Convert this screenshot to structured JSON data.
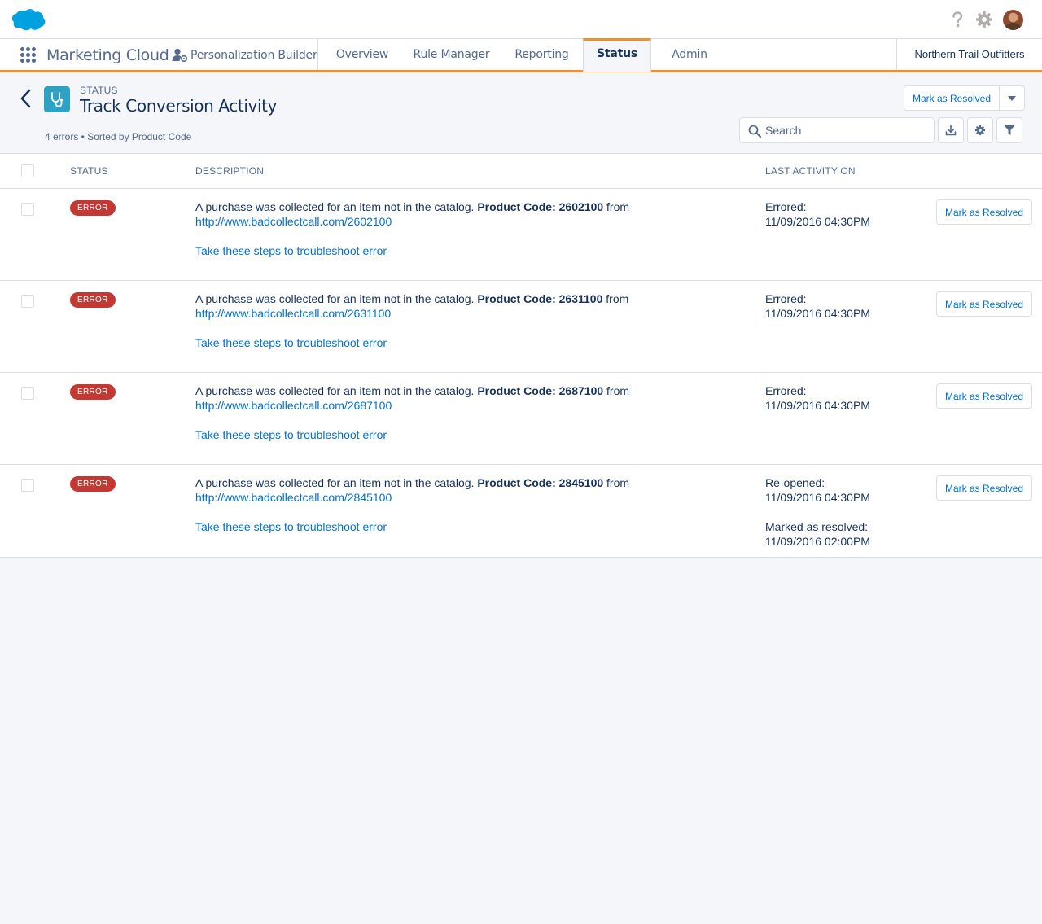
{
  "global_header": {
    "logo": "salesforce-cloud-logo",
    "icons": [
      "help-icon",
      "gear-icon",
      "user-avatar"
    ]
  },
  "nav": {
    "app_name": "Marketing Cloud",
    "product_label": "Personalization Builder",
    "tabs": [
      {
        "label": "Overview"
      },
      {
        "label": "Rule Manager"
      },
      {
        "label": "Reporting"
      },
      {
        "label": "Status",
        "active": true
      },
      {
        "label": "Admin"
      }
    ],
    "org_name": "Northern Trail Outfitters"
  },
  "page_header": {
    "eyebrow": "STATUS",
    "title": "Track Conversion Activity",
    "meta": "4 errors • Sorted by Product Code",
    "primary_button": "Mark as Resolved",
    "search_placeholder": "Search"
  },
  "table": {
    "columns": {
      "status": "STATUS",
      "description": "DESCRIPTION",
      "last_activity": "LAST ACTIVITY ON"
    },
    "rows": [
      {
        "badge": "ERROR",
        "desc_prefix": "A purchase was collected for an item not in the catalog.",
        "product_code": "Product Code: 2602100",
        "desc_suffix": "from",
        "url": "http://www.badcollectcall.com/2602100",
        "troubleshoot": "Take these steps to troubleshoot error",
        "activity1_label": "Errored:",
        "activity1_date": "11/09/2016 04:30PM",
        "activity2_label": "",
        "activity2_date": "",
        "action": "Mark as Resolved"
      },
      {
        "badge": "ERROR",
        "desc_prefix": "A purchase was collected for an item not in the catalog.",
        "product_code": "Product Code: 2631100",
        "desc_suffix": "from",
        "url": "http://www.badcollectcall.com/2631100",
        "troubleshoot": "Take these steps to troubleshoot error",
        "activity1_label": "Errored:",
        "activity1_date": "11/09/2016 04:30PM",
        "activity2_label": "",
        "activity2_date": "",
        "action": "Mark as Resolved"
      },
      {
        "badge": "ERROR",
        "desc_prefix": "A purchase was collected for an item not in the catalog.",
        "product_code": "Product Code: 2687100",
        "desc_suffix": "from",
        "url": "http://www.badcollectcall.com/2687100",
        "troubleshoot": "Take these steps to troubleshoot error",
        "activity1_label": "Errored:",
        "activity1_date": "11/09/2016 04:30PM",
        "activity2_label": "",
        "activity2_date": "",
        "action": "Mark as Resolved"
      },
      {
        "badge": "ERROR",
        "desc_prefix": "A purchase was collected for an item not in the catalog.",
        "product_code": "Product Code: 2845100",
        "desc_suffix": "from",
        "url": "http://www.badcollectcall.com/2845100",
        "troubleshoot": "Take these steps to troubleshoot error",
        "activity1_label": "Re-opened:",
        "activity1_date": "11/09/2016 04:30PM",
        "activity2_label": "Marked as resolved:",
        "activity2_date": "11/09/2016 02:00PM",
        "action": "Mark as Resolved"
      }
    ]
  },
  "colors": {
    "brand_blue": "#00a1e0",
    "link": "#0070d2",
    "text": "#16325c",
    "muted": "#54698d",
    "tab_accent": "#f38f2a",
    "error_badge": "#c23934",
    "object_icon_bg": "#2fa2c4",
    "page_bg": "#f4f6f9"
  }
}
